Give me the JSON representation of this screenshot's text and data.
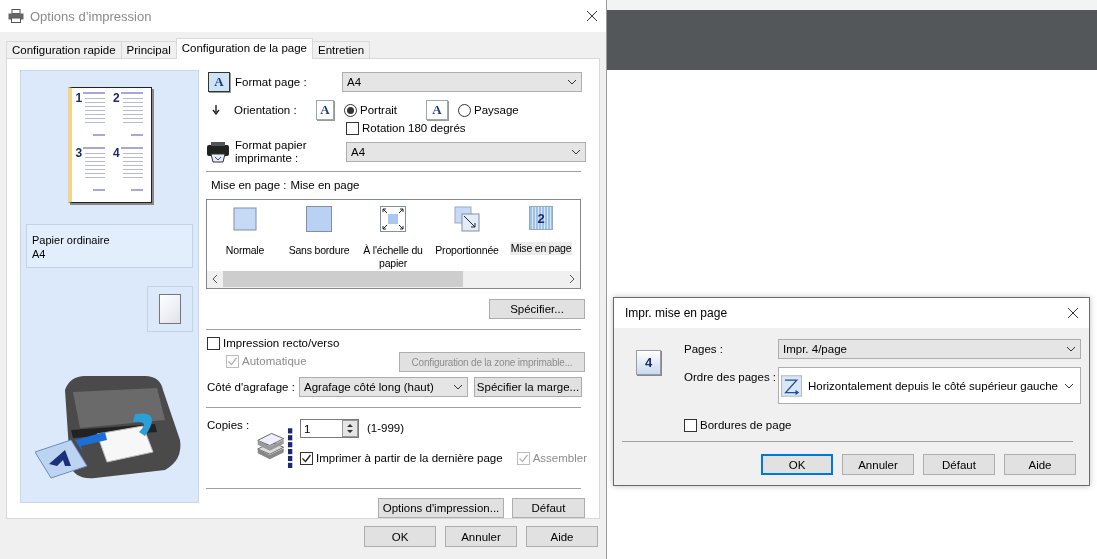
{
  "main_window": {
    "title": "Options d’impression",
    "tabs": [
      {
        "label": "Configuration rapide",
        "selected": false
      },
      {
        "label": "Principal",
        "selected": false
      },
      {
        "label": "Configuration de la page",
        "selected": true
      },
      {
        "label": "Entretien",
        "selected": false
      }
    ],
    "preview": {
      "page_numbers": [
        "1",
        "2",
        "3",
        "4"
      ],
      "paper_type": "Papier ordinaire",
      "paper_size": "A4"
    },
    "page_format": {
      "label": "Format page :",
      "value": "A4",
      "icon_text": "A"
    },
    "orientation": {
      "label": "Orientation :",
      "options": [
        {
          "label": "Portrait",
          "selected": true,
          "icon_text": "A"
        },
        {
          "label": "Paysage",
          "selected": false,
          "icon_text": "A"
        }
      ]
    },
    "rotation": {
      "label": "Rotation 180 degrés",
      "checked": false
    },
    "printer_paper": {
      "label": "Format papier imprimante :",
      "value": "A4"
    },
    "layout": {
      "label": "Mise en page :",
      "value": "Mise en page",
      "items": [
        {
          "label": "Normale",
          "selected": false,
          "kind": "normal"
        },
        {
          "label": "Sans bordure",
          "selected": false,
          "kind": "borderless"
        },
        {
          "label": "À l'échelle du papier",
          "selected": false,
          "kind": "fit"
        },
        {
          "label": "Proportionnée",
          "selected": false,
          "kind": "scaled"
        },
        {
          "label": "Mise en page",
          "selected": true,
          "kind": "layout",
          "icon_text": "2"
        }
      ]
    },
    "specify_button": "Spécifier...",
    "duplex": {
      "label": "Impression recto/verso",
      "checked": false
    },
    "automatic": {
      "label": "Automatique",
      "checked": true,
      "disabled": true
    },
    "print_area_button": {
      "label": "Configuration de la zone imprimable...",
      "disabled": true
    },
    "stapling": {
      "label": "Côté d'agrafage :",
      "value": "Agrafage côté long (haut)"
    },
    "margin_button": "Spécifier la marge...",
    "copies": {
      "label": "Copies :",
      "value": "1",
      "range": "(1-999)"
    },
    "reverse": {
      "label": "Imprimer à partir de la dernière page",
      "checked": true,
      "disabled": false
    },
    "collate": {
      "label": "Assembler",
      "checked": true,
      "disabled": true
    },
    "panel_buttons": [
      "Options d'impression...",
      "Défaut"
    ],
    "buttons": [
      "OK",
      "Annuler",
      "Aide"
    ]
  },
  "layout_dialog": {
    "title": "Impr. mise en page",
    "icon_text": "4",
    "pages": {
      "label": "Pages :",
      "value": "Impr. 4/page"
    },
    "order": {
      "label": "Ordre des pages :",
      "value": "Horizontalement depuis le côté supérieur gauche"
    },
    "borders": {
      "label": "Bordures de page",
      "checked": false
    },
    "buttons": [
      {
        "label": "OK",
        "selected": true
      },
      {
        "label": "Annuler",
        "selected": false
      },
      {
        "label": "Défaut",
        "selected": false
      },
      {
        "label": "Aide",
        "selected": false
      }
    ]
  }
}
